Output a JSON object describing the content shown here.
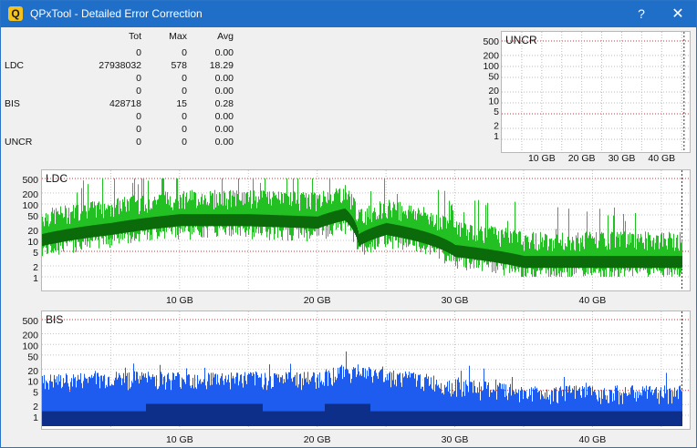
{
  "window": {
    "title": "QPxTool - Detailed Error Correction",
    "help_label": "?",
    "close_label": "✕",
    "app_icon_letter": "Q"
  },
  "stats": {
    "headers": {
      "tot": "Tot",
      "max": "Max",
      "avg": "Avg"
    },
    "rows": [
      {
        "label": "",
        "tot": "0",
        "max": "0",
        "avg": "0.00"
      },
      {
        "label": "LDC",
        "tot": "27938032",
        "max": "578",
        "avg": "18.29"
      },
      {
        "label": "",
        "tot": "0",
        "max": "0",
        "avg": "0.00"
      },
      {
        "label": "",
        "tot": "0",
        "max": "0",
        "avg": "0.00"
      },
      {
        "label": "BIS",
        "tot": "428718",
        "max": "15",
        "avg": "0.28"
      },
      {
        "label": "",
        "tot": "0",
        "max": "0",
        "avg": "0.00"
      },
      {
        "label": "",
        "tot": "0",
        "max": "0",
        "avg": "0.00"
      },
      {
        "label": "UNCR",
        "tot": "0",
        "max": "0",
        "avg": "0.00"
      }
    ]
  },
  "charts": {
    "uncr": {
      "label": "UNCR",
      "y_ticks": [
        "500",
        "200",
        "100",
        "50",
        "20",
        "10",
        "5",
        "2",
        "1"
      ],
      "x_ticks": [
        "10 GB",
        "20 GB",
        "30 GB",
        "40 GB"
      ]
    },
    "ldc": {
      "label": "LDC",
      "y_ticks": [
        "500",
        "200",
        "100",
        "50",
        "20",
        "10",
        "5",
        "2",
        "1"
      ],
      "x_ticks": [
        "10 GB",
        "20 GB",
        "30 GB",
        "40 GB"
      ]
    },
    "bis": {
      "label": "BIS",
      "y_ticks": [
        "500",
        "200",
        "100",
        "50",
        "20",
        "10",
        "5",
        "2",
        "1"
      ],
      "x_ticks": [
        "10 GB",
        "20 GB",
        "30 GB",
        "40 GB"
      ]
    }
  },
  "chart_data": [
    {
      "type": "area",
      "name": "UNCR",
      "scale": "log",
      "ylim": [
        1,
        500
      ],
      "xlim": [
        0,
        47
      ],
      "x": [
        0,
        47
      ],
      "values": [
        0,
        0
      ]
    },
    {
      "type": "area",
      "name": "LDC",
      "scale": "log",
      "ylim": [
        1,
        500
      ],
      "xlim": [
        0,
        47
      ],
      "x": [
        0,
        5,
        10,
        15,
        20,
        22,
        23,
        25,
        30,
        35,
        40,
        46.5
      ],
      "values": [
        20,
        40,
        70,
        70,
        60,
        100,
        20,
        40,
        10,
        5,
        5,
        5
      ],
      "colors": {
        "max": "#22c022",
        "avg": "#0b6b0b",
        "limit": "#cc2020"
      }
    },
    {
      "type": "area",
      "name": "BIS",
      "scale": "log",
      "ylim": [
        1,
        500
      ],
      "xlim": [
        0,
        47
      ],
      "x": [
        0,
        5,
        10,
        15,
        20,
        22,
        25,
        30,
        35,
        40,
        46.5
      ],
      "values": [
        4,
        5,
        5,
        5,
        5,
        8,
        6,
        3,
        2,
        2,
        2
      ],
      "colors": {
        "max": "#1e5cf0",
        "avg": "#0d2f8a",
        "limit": "#cc2020"
      }
    }
  ]
}
